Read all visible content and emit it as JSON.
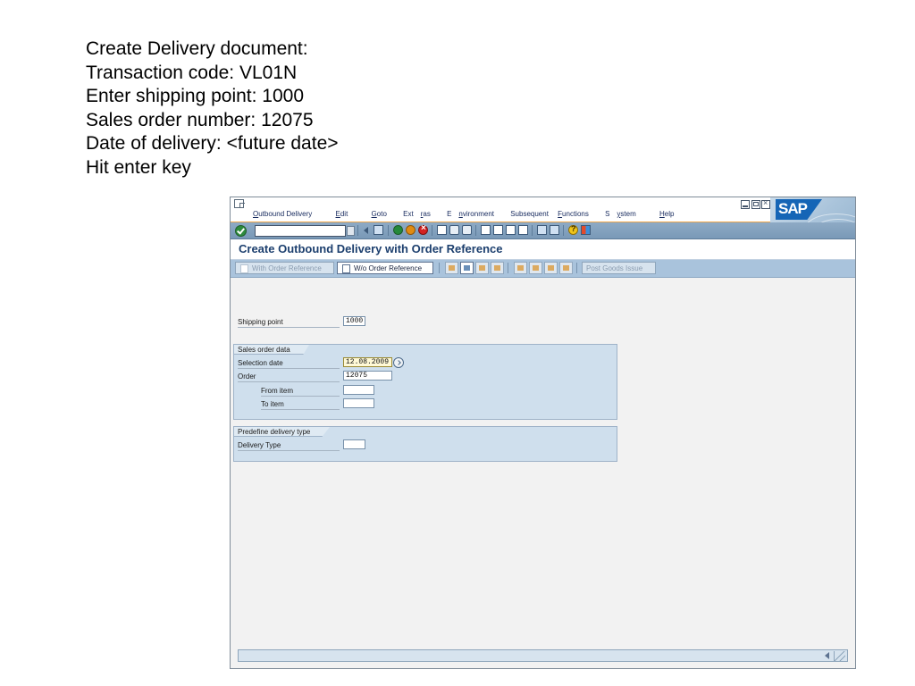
{
  "instructions": [
    "Create Delivery document:",
    "Transaction code: VL01N",
    "Enter shipping point: 1000",
    "Sales order number: 12075",
    "Date of delivery: <future date>",
    "Hit enter key"
  ],
  "menubar": {
    "items": [
      {
        "pre": "",
        "ul": "O",
        "post": "utbound Delivery"
      },
      {
        "pre": "",
        "ul": "E",
        "post": "dit"
      },
      {
        "pre": "",
        "ul": "G",
        "post": "oto"
      },
      {
        "pre": "Ext",
        "ul": "r",
        "post": "as"
      },
      {
        "pre": "E",
        "ul": "n",
        "post": "vironment"
      },
      {
        "pre": "Subsequent ",
        "ul": "F",
        "post": "unctions"
      },
      {
        "pre": "S",
        "ul": "y",
        "post": "stem"
      },
      {
        "pre": "",
        "ul": "H",
        "post": "elp"
      }
    ],
    "brand": "SAP"
  },
  "systoolbar": {
    "command_value": "",
    "icons": [
      "check-icon",
      "save-icon",
      "back-icon",
      "exit-icon",
      "cancel-icon",
      "print-icon",
      "find-icon",
      "find-next-icon",
      "first-page-icon",
      "previous-page-icon",
      "next-page-icon",
      "last-page-icon",
      "create-session-icon",
      "shortcut-icon",
      "help-icon",
      "layout-menu-icon"
    ]
  },
  "screen": {
    "title": "Create Outbound Delivery with Order Reference"
  },
  "apptoolbar": {
    "with_order_reference": "With Order Reference",
    "wo_order_reference": "W/o Order Reference",
    "post_goods_issue": "Post Goods Issue"
  },
  "form": {
    "shipping_point_label": "Shipping point",
    "shipping_point_value": "1000",
    "sales_order_group": "Sales order data",
    "selection_date_label": "Selection date",
    "selection_date_value": "12.08.2009",
    "order_label": "Order",
    "order_value": "12075",
    "from_item_label": "From item",
    "from_item_value": "",
    "to_item_label": "To item",
    "to_item_value": "",
    "predefine_group": "Predefine delivery type",
    "delivery_type_label": "Delivery Type",
    "delivery_type_value": ""
  },
  "colors": {
    "menu_underline": "#f0a74a",
    "toolbar": "#7999b7",
    "app_toolbar": "#a9c3dc",
    "groupbox": "#cfdfed",
    "required_field": "#fff9d6"
  }
}
